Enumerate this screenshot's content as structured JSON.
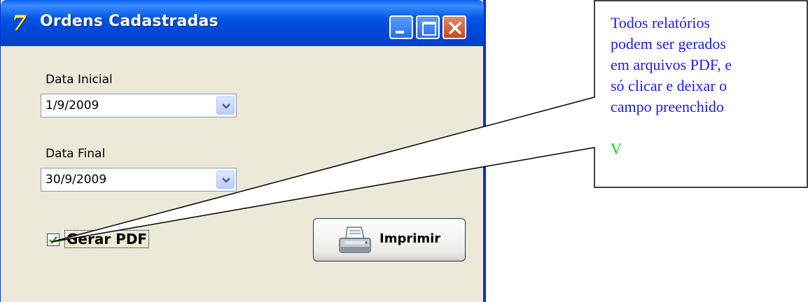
{
  "window": {
    "title": "Ordens Cadastradas",
    "icon": "app-logo-icon",
    "icon_glyph": "7",
    "controls": [
      "minimize-icon",
      "maximize-icon",
      "close-icon"
    ]
  },
  "form": {
    "data_inicial_label": "Data Inicial",
    "data_inicial_value": "1/9/2009",
    "data_final_label": "Data Final",
    "data_final_value": "30/9/2009",
    "gerar_pdf_label": "Gerar PDF",
    "gerar_pdf_checked": true,
    "print_button_label": "Imprimir",
    "print_button_icon": "printer-icon"
  },
  "callout": {
    "lines": [
      "Todos relatórios",
      "podem ser gerados",
      "em arquivos PDF, e",
      "só clicar e deixar o",
      "campo preenchido"
    ],
    "mark": "V",
    "text_color": "#1a1aff",
    "mark_color": "#00dd00"
  },
  "colors": {
    "titlebar": "#0055e5",
    "window_bg": "#ece9d8",
    "close_button": "#c9461c"
  }
}
